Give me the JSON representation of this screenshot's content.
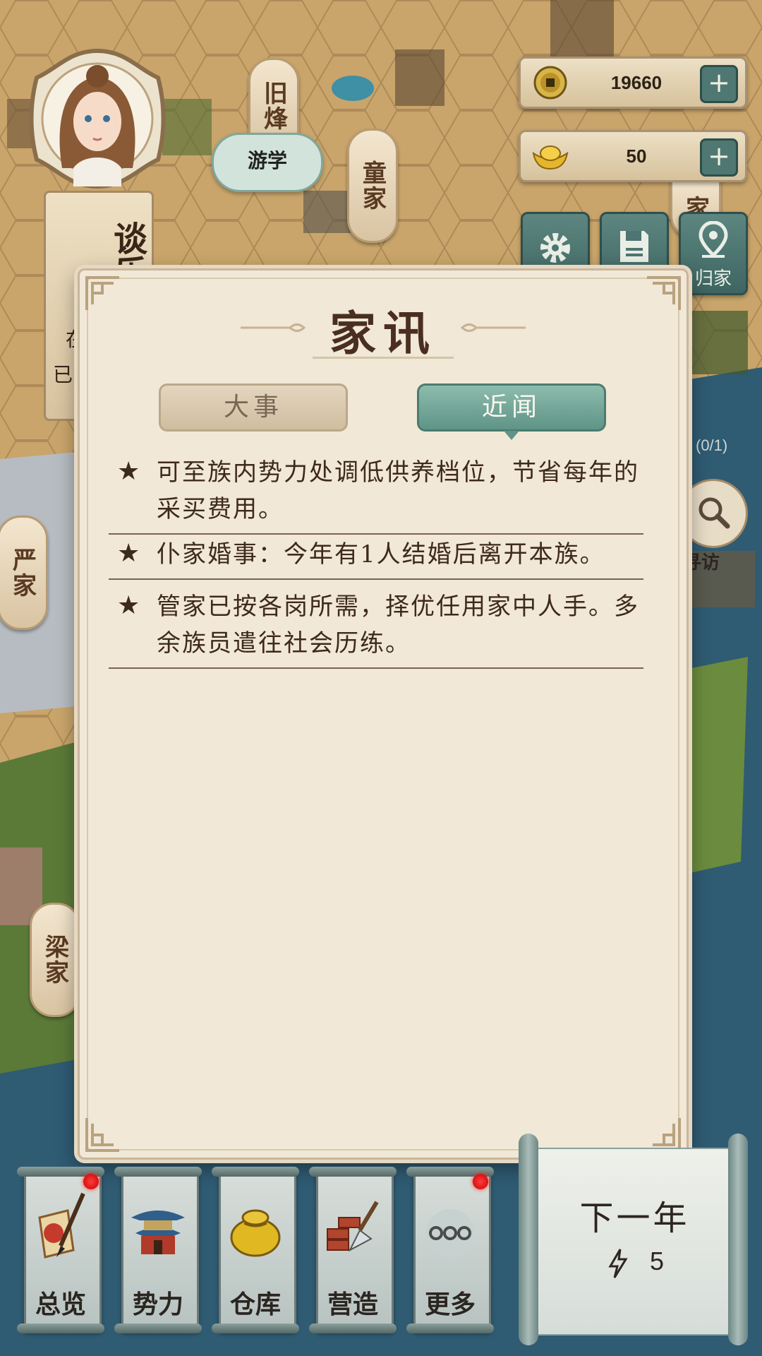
{
  "resources": {
    "coins": "19660",
    "ingots": "50"
  },
  "hud": {
    "home_label": "归家",
    "visit_label": "寻访",
    "visit_count": "(0/1)",
    "activity_bubble": "游学"
  },
  "map_labels": {
    "jiu": "旧烽",
    "tong": "童家",
    "yan": "严家",
    "liang": "梁家",
    "jia_right": "家"
  },
  "character": {
    "name": "谈乐",
    "status_line1": "在",
    "status_line2": "已"
  },
  "modal": {
    "title": "家讯",
    "tabs": [
      {
        "label": "大事",
        "active": false
      },
      {
        "label": "近闻",
        "active": true
      }
    ],
    "items": [
      "可至族内势力处调低供养档位，节省每年的采买费用。",
      "仆家婚事：今年有1人结婚后离开本族。",
      "管家已按各岗所需，择优任用家中人手。多余族员遣往社会历练。"
    ]
  },
  "bottom_menu": [
    {
      "label": "总览",
      "icon": "scroll-brush-icon",
      "badge": true
    },
    {
      "label": "势力",
      "icon": "pavilion-icon",
      "badge": false
    },
    {
      "label": "仓库",
      "icon": "money-bag-icon",
      "badge": false
    },
    {
      "label": "营造",
      "icon": "bricks-trowel-icon",
      "badge": false
    },
    {
      "label": "更多",
      "icon": "more-dots-icon",
      "badge": true
    }
  ],
  "next_year": {
    "label": "下一年",
    "energy": "5"
  },
  "colors": {
    "teal": "#5f9487",
    "parchment": "#f1e8d7",
    "ink": "#3e2a1d",
    "badge_red": "#e01010"
  }
}
